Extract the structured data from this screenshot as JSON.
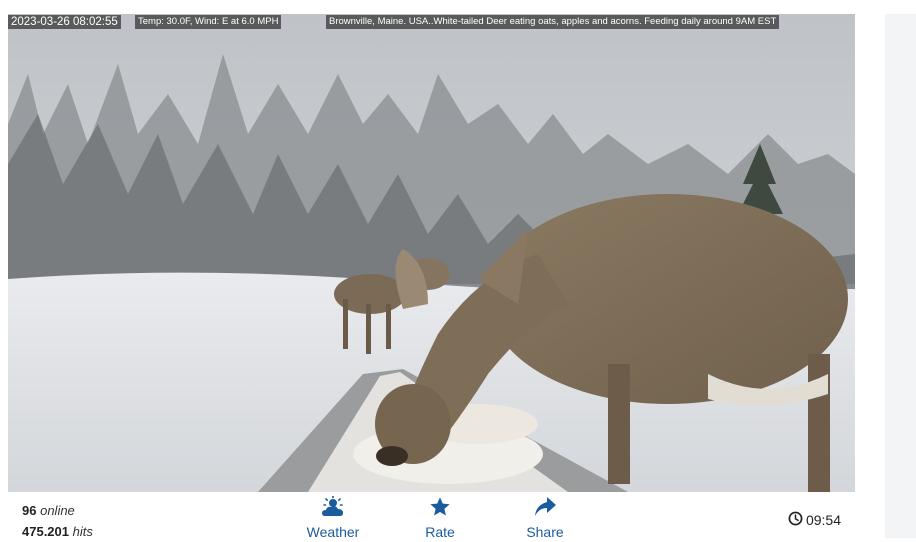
{
  "video": {
    "timestamp": "2023-03-26 08:02:55",
    "weather": "Temp: 30.0F, Wind: E at 6.0 MPH",
    "caption": "Brownville, Maine. USA..White-tailed Deer eating oats, apples and acorns. Feeding daily around 9AM EST"
  },
  "stats": {
    "online_count": "96",
    "online_label": "online",
    "hits_count": "475.201",
    "hits_label": "hits"
  },
  "actions": [
    {
      "label": "Weather",
      "icon": "weather-icon"
    },
    {
      "label": "Rate",
      "icon": "star-icon"
    },
    {
      "label": "Share",
      "icon": "share-icon"
    }
  ],
  "clock": {
    "time": "09:54",
    "icon": "clock-icon"
  },
  "colors": {
    "accent": "#1b5c9e"
  }
}
